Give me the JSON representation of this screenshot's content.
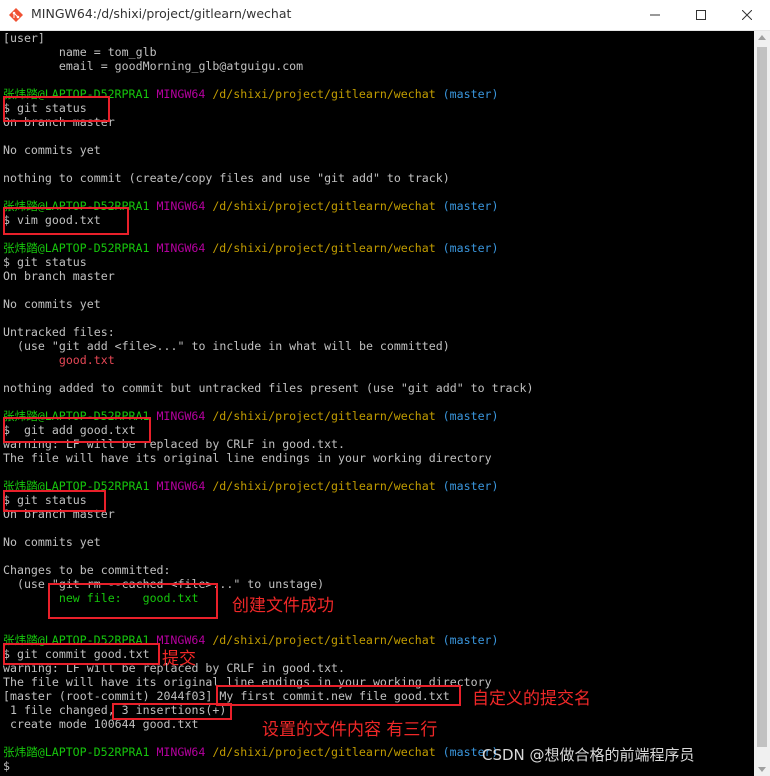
{
  "window": {
    "title": "MINGW64:/d/shixi/project/gitlearn/wechat",
    "colors": {
      "user": "#16c60c",
      "host": "#b4009e",
      "path": "#c19c00",
      "branch": "#3a96dd",
      "annotation": "#e8202a"
    }
  },
  "prompt": {
    "user": "张炜踏@LAPTOP-D52RPRA1",
    "shell": "MINGW64",
    "path": "/d/shixi/project/gitlearn/wechat",
    "branch": "(master)"
  },
  "terminal": {
    "config_header": "[user]",
    "config_name": "        name = tom_glb",
    "config_email": "        email = goodMorning_glb@atguigu.com",
    "cmd1": "$ git status",
    "on_branch": "On branch master",
    "no_commits": "No commits yet",
    "nothing_to_commit": "nothing to commit (create/copy files and use \"git add\" to track)",
    "cmd2": "$ vim good.txt",
    "cmd3": "$ git status",
    "untracked_header": "Untracked files:",
    "untracked_hint": "  (use \"git add <file>...\" to include in what will be committed)",
    "untracked_file": "        good.txt",
    "nothing_added": "nothing added to commit but untracked files present (use \"git add\" to track)",
    "cmd4": "$  git add good.txt",
    "warning_lf": "warning: LF will be replaced by CRLF in good.txt.",
    "line_endings": "The file will have its original line endings in your working directory",
    "cmd5": "$ git status",
    "changes_header": "Changes to be committed:",
    "unstage_hint": "  (use \"git rm --cached <file>...\" to unstage)",
    "new_file": "        new file:   good.txt",
    "cmd6": "$ git commit good.txt",
    "commit_result": "[master (root-commit) 2044f03] My first commit.new file good.txt",
    "files_changed": " 1 file changed, 3 insertions(+)",
    "create_mode": " create mode 100644 good.txt",
    "final_prompt": "$"
  },
  "annotations": {
    "create_success": "创建文件成功",
    "commit": "提交",
    "custom_commit_name": "自定义的提交名",
    "file_content_lines": "设置的文件内容 有三行"
  },
  "watermark": "CSDN @想做合格的前端程序员"
}
